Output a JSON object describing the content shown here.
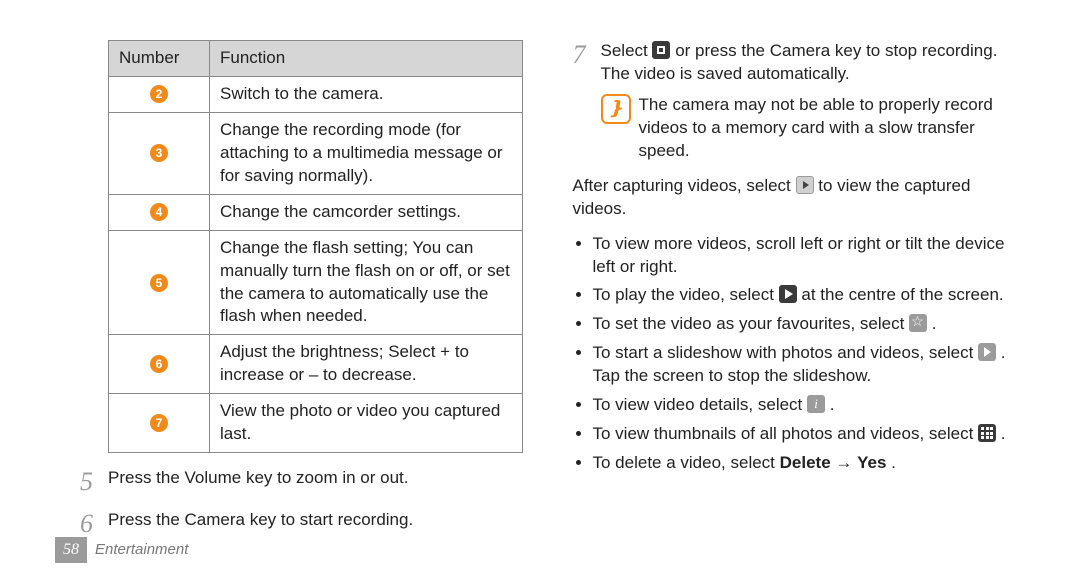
{
  "table": {
    "header": {
      "c1": "Number",
      "c2": "Function"
    },
    "rows": [
      {
        "n": "2",
        "fn": "Switch to the camera."
      },
      {
        "n": "3",
        "fn": "Change the recording mode (for attaching to a multimedia message or for saving normally)."
      },
      {
        "n": "4",
        "fn": "Change the camcorder settings."
      },
      {
        "n": "5",
        "fn": "Change the flash setting; You can manually turn the flash on or off, or set the camera to automatically use the flash when needed."
      },
      {
        "n": "6",
        "fn": "Adjust the brightness; Select + to increase or – to decrease."
      },
      {
        "n": "7",
        "fn": "View the photo or video you captured last."
      }
    ]
  },
  "steps": {
    "s5": {
      "num": "5",
      "text": "Press the Volume key to zoom in or out."
    },
    "s6": {
      "num": "6",
      "text": "Press the Camera key to start recording."
    },
    "s7": {
      "num": "7",
      "pre": "Select ",
      "post": " or press the Camera key to stop recording. The video is saved automatically."
    }
  },
  "note": "The camera may not be able to properly record videos to a memory card with a slow transfer speed.",
  "after": {
    "pre": "After capturing videos, select ",
    "post": " to view the captured videos."
  },
  "bullets": {
    "b1": "To view more videos, scroll left or right or tilt the device left or right.",
    "b2": {
      "pre": "To play the video, select ",
      "post": " at the centre of the screen."
    },
    "b3": {
      "pre": "To set the video as your favourites, select ",
      "post": "."
    },
    "b4": {
      "pre": "To start a slideshow with photos and videos, select ",
      "post": ". Tap the screen to stop the slideshow."
    },
    "b5": {
      "pre": "To view video details, select ",
      "post": "."
    },
    "b6": {
      "pre": "To view thumbnails of all photos and videos, select ",
      "post": "."
    },
    "b7": {
      "pre": "To delete a video, select ",
      "bold1": "Delete",
      "mid": " → ",
      "bold2": "Yes",
      "post": "."
    }
  },
  "footer": {
    "page": "58",
    "section": "Entertainment"
  }
}
